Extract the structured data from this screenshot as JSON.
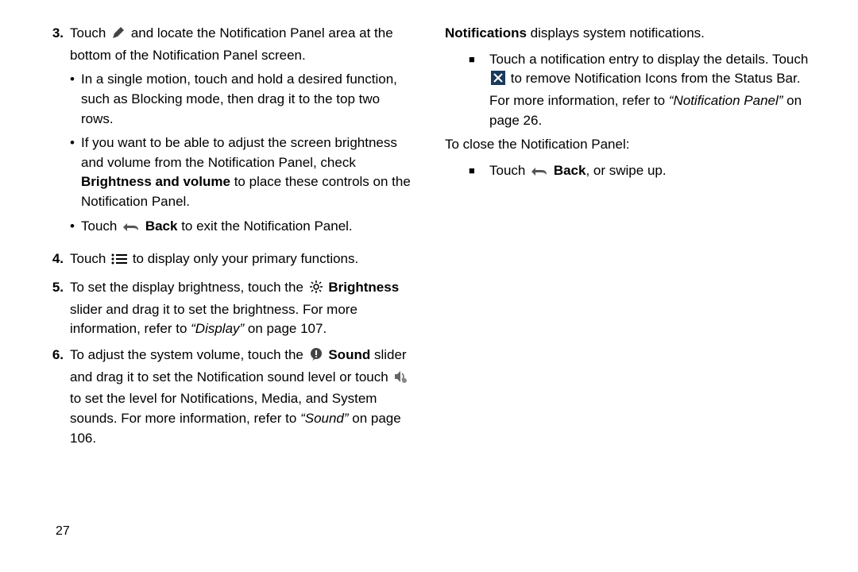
{
  "left": {
    "item3": {
      "num": "3.",
      "line1a": "Touch ",
      "line1b": " and locate the Notification Panel area at the bottom of the Notification Panel screen.",
      "b1": "In a single motion, touch and hold a desired function, such as Blocking mode, then drag it to the top two rows.",
      "b2a": "If you want to be able to adjust the screen brightness and volume from the Notification Panel, check ",
      "b2_bold": "Brightness and volume",
      "b2b": " to place these controls on the Notification Panel.",
      "b3a": "Touch ",
      "b3_bold": "Back",
      "b3b": " to exit the Notification Panel."
    },
    "item4": {
      "num": "4.",
      "a": "Touch ",
      "b": " to display only your primary functions."
    },
    "item5": {
      "num": "5.",
      "a": "To set the display brightness, touch the ",
      "bold": "Brightness",
      "b": " slider and drag it to set the brightness. For more information, refer to ",
      "ital": "“Display”",
      "c": " on page 107."
    },
    "item6": {
      "num": "6.",
      "a": "To adjust the system volume, touch the ",
      "bold": "Sound",
      "b": " slider and drag it to set the Notification sound level or touch ",
      "c": " to set the level for Notifications, Media, and System sounds. For more information, refer to ",
      "ital": "“Sound”",
      "d": " on page 106."
    }
  },
  "right": {
    "p1_bold": "Notifications",
    "p1": " displays system notifications.",
    "sq1a": "Touch a notification entry to display the details. Touch ",
    "sq1b": " to remove Notification Icons from the Status Bar. For more information, refer to ",
    "sq1_ital": "“Notification Panel”",
    "sq1c": " on page 26.",
    "p2": "To close the Notification Panel:",
    "sq2a": "Touch ",
    "sq2_bold": "Back",
    "sq2b": ", or swipe up."
  },
  "page_number": "27"
}
